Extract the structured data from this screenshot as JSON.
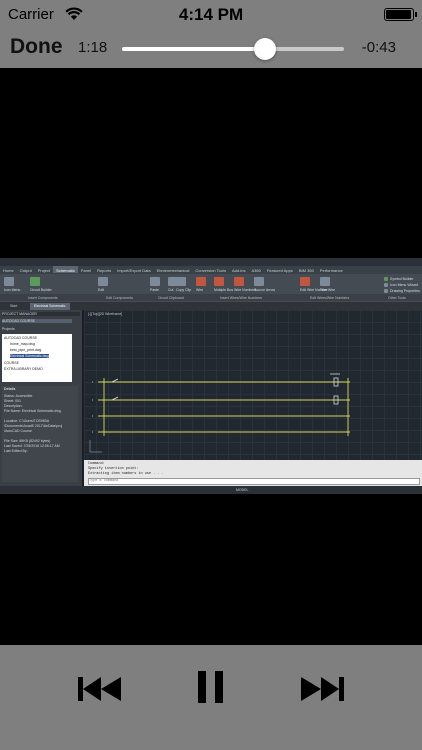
{
  "status_bar": {
    "carrier": "Carrier",
    "time": "4:14 PM",
    "battery_level": 0.95,
    "icons": [
      "wifi-icon",
      "battery-icon"
    ]
  },
  "player": {
    "done_label": "Done",
    "elapsed": "1:18",
    "remaining": "-0:43",
    "progress": 0.645,
    "buttons": [
      "previous-track-icon",
      "pause-icon",
      "next-track-icon"
    ],
    "colors": {
      "bar": "#7f7f7f",
      "slider_track": "#c9c9c9",
      "slider_fill": "#ffffff"
    }
  },
  "video": {
    "tabs": [
      "Home",
      "Output",
      "Project",
      "Schematic",
      "Panel",
      "Reports",
      "Import/Export Data",
      "Electromechanical",
      "Conversion Tools",
      "Add-ins",
      "A360",
      "Featured Apps",
      "BIM 360",
      "Performance"
    ],
    "ribbon_labels": [
      "Icon Menu",
      "Circuit Builder",
      "Edit",
      "Paste",
      "Cut",
      "Copy Clip",
      "Wire",
      "Multiple Bus",
      "Wire Numbers",
      "Source Arrow",
      "Edit Wire Number",
      "Trim Wire",
      "Symbol Builder",
      "Icon Menu Wizard",
      "Drawing Properties"
    ],
    "panel_labels": [
      "Insert Components",
      "Edit Components",
      "Circuit Clipboard",
      "Insert Wires/Wire Numbers",
      "Edit Wires/Wire Numbers",
      "Other Tools"
    ],
    "doc_tabs": [
      "Start",
      "Electrical Schematic"
    ],
    "viewport_label": "[-][Top][2D Wireframe]",
    "left_panel": {
      "title": "PROJECT MANAGER",
      "dropdown": "AUTOCAD COURSE",
      "projects_header": "Projects",
      "tree": [
        "AUTOCAD COURSE",
        "home_map.dwg",
        "best_pipe_print.dwg",
        "Electrical Schematic.dwg",
        "COURSE",
        "EXTRA LIBRARY DEMO"
      ],
      "details_header": "Details",
      "details": [
        "Status: Accessible",
        "Sheet: 001",
        "Description:",
        "File Name: Electrical Schematic.dwg",
        "",
        "Location: C:\\Users\\TOSHIBA",
        "\\Documents\\AcadE 2017\\AeData\\proj",
        "\\AutoCAD Course",
        "",
        "File Size: 89KB (82492 bytes)",
        "Last Saved: 7/28/2016 12:06:17 AM",
        "Last Edited By:"
      ]
    },
    "command_lines": [
      "Command:",
      "Specify insertion point:",
      "Extracting item numbers in use . . ."
    ],
    "command_placeholder": "Type a command",
    "status_model": "MODEL"
  }
}
